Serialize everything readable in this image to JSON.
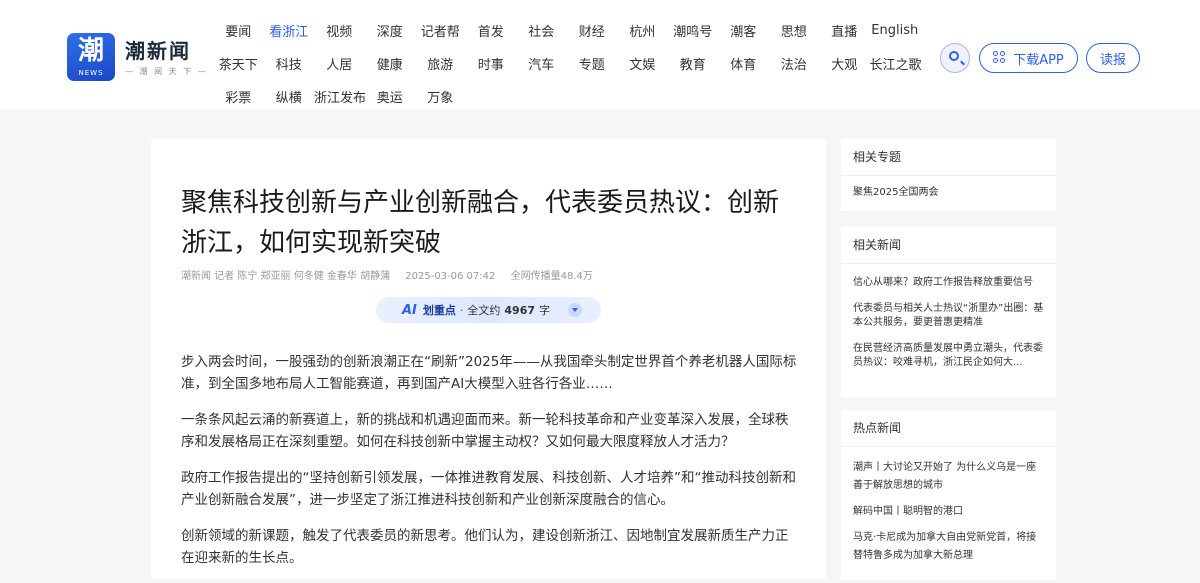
{
  "brand": {
    "logo_glyph": "潮",
    "logo_en": "NEWS",
    "name": "潮新闻",
    "slogan": "— 潮 阅 天 下 —"
  },
  "nav": {
    "rows": [
      [
        "要闻",
        "看浙江",
        "视频",
        "深度",
        "记者帮",
        "首发",
        "社会",
        "财经",
        "杭州",
        "潮鸣号",
        "潮客",
        "思想",
        "直播",
        "English"
      ],
      [
        "茶天下",
        "科技",
        "人居",
        "健康",
        "旅游",
        "时事",
        "汽车",
        "专题",
        "文娱",
        "教育",
        "体育",
        "法治",
        "大观",
        "长江之歌"
      ],
      [
        "彩票",
        "纵横",
        "浙江发布",
        "奥运",
        "万象"
      ]
    ],
    "active": "看浙江"
  },
  "header_actions": {
    "download_app": "下载APP",
    "report": "读报"
  },
  "article": {
    "title": "聚焦科技创新与产业创新融合，代表委员热议：创新浙江，如何实现新突破",
    "source": "潮新闻 记者 陈宁 郑亚丽 何冬健 金春华 胡静蒲",
    "date": "2025-03-06 07:42",
    "spread": "全网传播量48.4万",
    "ai_logo": "AI",
    "ai_label": "划重点",
    "ai_dot": "·",
    "ai_prefix": "全文约",
    "ai_count": "4967",
    "ai_suffix": "字",
    "paragraphs": [
      "步入两会时间，一股强劲的创新浪潮正在“刷新”2025年——从我国牵头制定世界首个养老机器人国际标准，到全国多地布局人工智能赛道，再到国产AI大模型入驻各行各业……",
      "一条条风起云涌的新赛道上，新的挑战和机遇迎面而来。新一轮科技革命和产业变革深入发展，全球秩序和发展格局正在深刻重塑。如何在科技创新中掌握主动权？又如何最大限度释放人才活力？",
      "政府工作报告提出的“坚持创新引领发展，一体推进教育发展、科技创新、人才培养”和“推动科技创新和产业创新融合发展”，进一步坚定了浙江推进科技创新和产业创新深度融合的信心。",
      "创新领域的新课题，触发了代表委员的新思考。他们认为，建设创新浙江、因地制宜发展新质生产力正在迎来新的生长点。"
    ]
  },
  "sidebar": {
    "topics": {
      "title": "相关专题",
      "items": [
        "聚焦2025全国两会"
      ]
    },
    "related": {
      "title": "相关新闻",
      "items": [
        "信心从哪来？政府工作报告释放重要信号",
        "代表委员与相关人士热议“浙里办”出圈：基本公共服务，要更普惠更精准",
        "在民营经济高质量发展中勇立潮头，代表委员热议：咬难寻机，浙江民企如何大..."
      ]
    },
    "hot": {
      "title": "热点新闻",
      "items": [
        "潮声丨大讨论又开始了 为什么义乌是一座善于解放思想的城市",
        "解码中国丨聪明智的港口",
        "马克·卡尼成为加拿大自由党新党首，将接替特鲁多成为加拿大新总理"
      ]
    }
  },
  "colors": {
    "accent": "#2e61e6",
    "page_bg": "#f5f6f7"
  }
}
